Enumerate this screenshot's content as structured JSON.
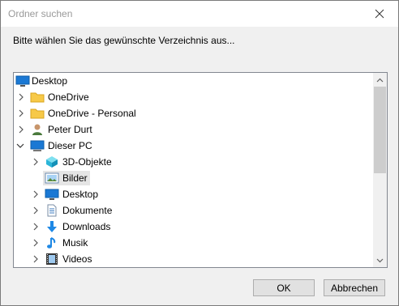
{
  "window": {
    "title": "Ordner suchen"
  },
  "prompt": "Bitte wählen Sie das gewünschte Verzeichnis aus...",
  "tree": [
    {
      "label": "Desktop",
      "icon": "desktop-icon"
    },
    {
      "label": "OneDrive",
      "icon": "folder-icon"
    },
    {
      "label": "OneDrive - Personal",
      "icon": "folder-icon"
    },
    {
      "label": "Peter Durt",
      "icon": "user-icon"
    },
    {
      "label": "Dieser PC",
      "icon": "computer-icon",
      "expanded": true
    },
    {
      "label": "3D-Objekte",
      "icon": "3d-objects-icon"
    },
    {
      "label": "Bilder",
      "icon": "pictures-icon",
      "selected": true
    },
    {
      "label": "Desktop",
      "icon": "desktop-icon"
    },
    {
      "label": "Dokumente",
      "icon": "documents-icon"
    },
    {
      "label": "Downloads",
      "icon": "downloads-icon"
    },
    {
      "label": "Musik",
      "icon": "music-icon"
    },
    {
      "label": "Videos",
      "icon": "videos-icon"
    }
  ],
  "buttons": {
    "ok": "OK",
    "cancel": "Abbrechen"
  },
  "colors": {
    "folder": "#f7c948",
    "monitor": "#1a78d4",
    "accent": "#0078d7",
    "selection": "#e5e5e5"
  }
}
